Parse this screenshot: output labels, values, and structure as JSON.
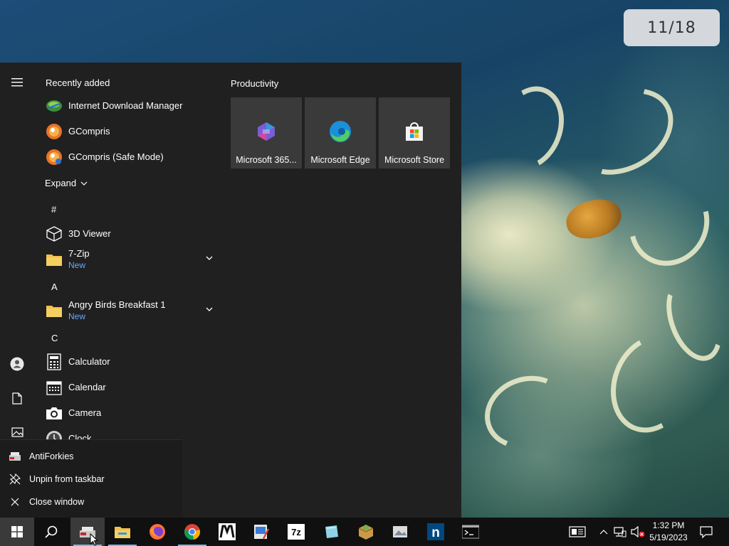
{
  "slide_counter": "11/18",
  "start_menu": {
    "recently_added_title": "Recently added",
    "recently_added": [
      {
        "label": "Internet Download Manager",
        "icon": "idm-icon"
      },
      {
        "label": "GCompris",
        "icon": "gcompris-icon"
      },
      {
        "label": "GCompris (Safe Mode)",
        "icon": "gcompris-icon"
      }
    ],
    "expand_label": "Expand",
    "groups": [
      {
        "letter": "#",
        "items": [
          {
            "label": "3D Viewer",
            "sub": ""
          },
          {
            "label": "7-Zip",
            "sub": "New"
          }
        ]
      },
      {
        "letter": "A",
        "items": [
          {
            "label": "Angry Birds Breakfast 1",
            "sub": "New"
          }
        ]
      },
      {
        "letter": "C",
        "items": [
          {
            "label": "Calculator",
            "sub": ""
          },
          {
            "label": "Calendar",
            "sub": ""
          },
          {
            "label": "Camera",
            "sub": ""
          },
          {
            "label": "Clock",
            "sub": ""
          }
        ]
      }
    ],
    "tiles_group_title": "Productivity",
    "tiles": [
      {
        "label": "Microsoft 365...",
        "icon": "microsoft-365-icon"
      },
      {
        "label": "Microsoft Edge",
        "icon": "edge-icon"
      },
      {
        "label": "Microsoft Store",
        "icon": "store-icon"
      }
    ]
  },
  "jump_list": {
    "items": [
      {
        "label": "AntiForkies",
        "icon": "antiforkies-icon"
      },
      {
        "label": "Unpin from taskbar",
        "icon": "unpin-icon"
      },
      {
        "label": "Close window",
        "icon": "close-icon"
      }
    ]
  },
  "taskbar": {
    "apps": [
      "start",
      "search",
      "antiforkies",
      "file-explorer",
      "firefox",
      "chrome",
      "m-app",
      "paint-app",
      "7zip",
      "notepad-app",
      "package-app",
      "photo-app",
      "nuget-app",
      "terminal"
    ],
    "time": "1:32 PM",
    "date": "5/19/2023"
  },
  "colors": {
    "start_bg": "#202020",
    "taskbar_bg": "#101010",
    "tile_bg": "#3a3a3a",
    "accent_new": "#66a9ff"
  }
}
